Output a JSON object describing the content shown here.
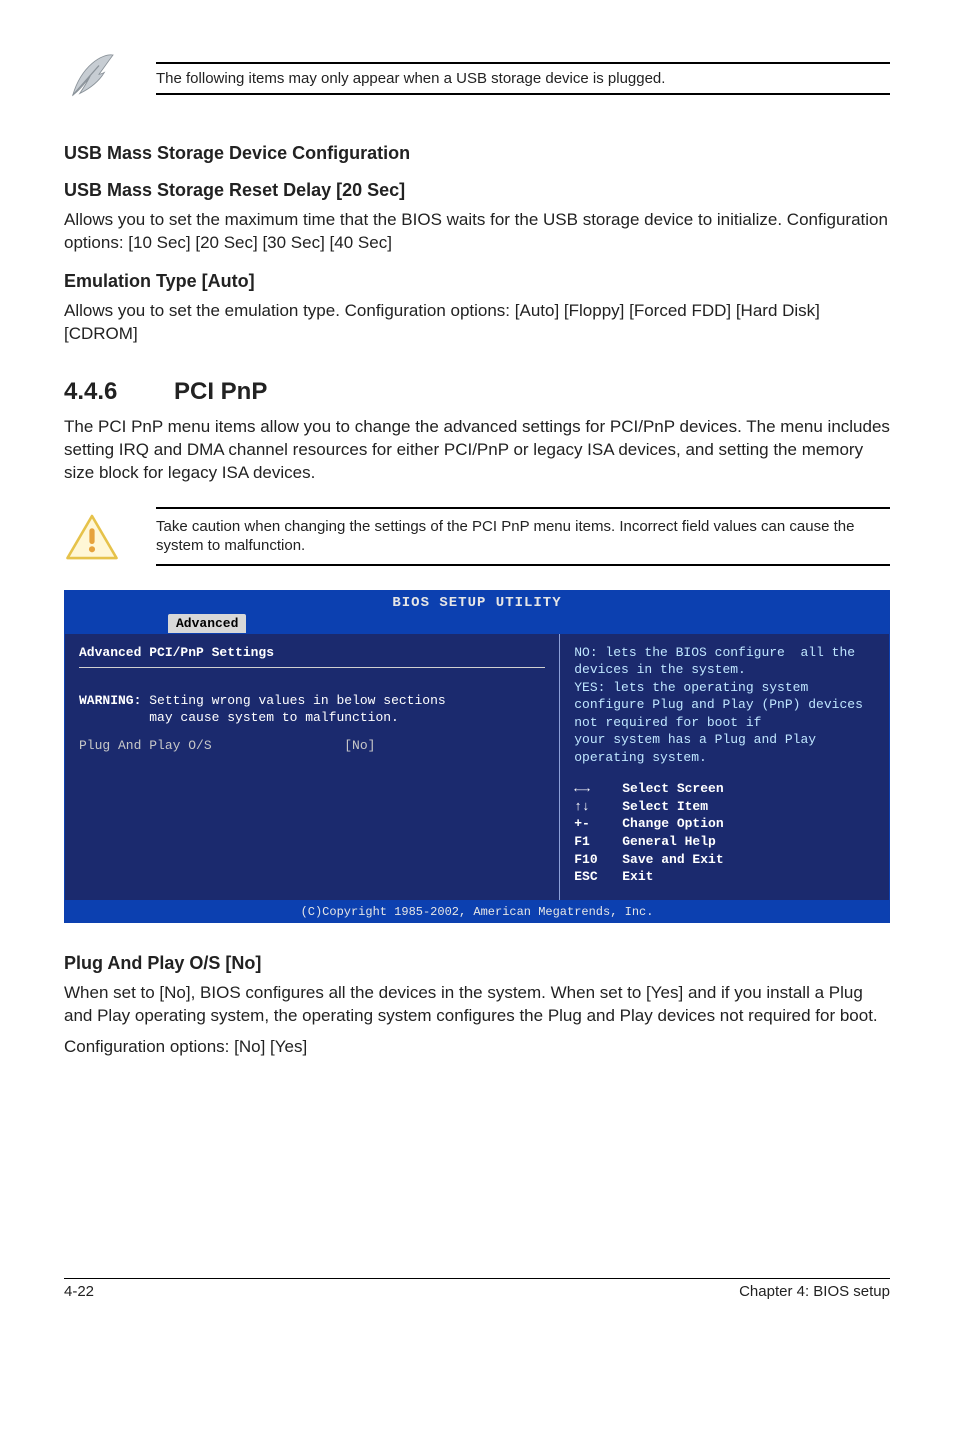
{
  "topnote": {
    "text": "The following items may only appear when a USB storage device is plugged."
  },
  "usbConfig": {
    "heading": "USB Mass Storage Device Configuration",
    "resetDelayHeading": "USB Mass Storage Reset Delay [20 Sec]",
    "resetDelayBody": "Allows you to set the maximum time that the BIOS waits for the USB storage device to initialize. Configuration options: [10 Sec] [20 Sec] [30 Sec] [40 Sec]",
    "emulationHeading": "Emulation Type [Auto]",
    "emulationBody": "Allows you to set the emulation type. Configuration options: [Auto] [Floppy] [Forced FDD] [Hard Disk] [CDROM]"
  },
  "section": {
    "number": "4.4.6",
    "title": "PCI PnP",
    "intro": "The PCI PnP menu items allow you to change the advanced settings for PCI/PnP devices. The menu includes setting IRQ and DMA channel resources for either PCI/PnP or legacy ISA devices, and setting the memory size block for legacy ISA devices."
  },
  "caution": {
    "text": "Take caution when changing the settings of the PCI PnP menu items. Incorrect field values can cause the system to malfunction."
  },
  "bios": {
    "title": "BIOS SETUP UTILITY",
    "tab": "Advanced",
    "leftTitle": "Advanced PCI/PnP Settings",
    "warningLabel": "WARNING:",
    "warningLine1": "Setting wrong values in below sections",
    "warningLine2": "may cause system to malfunction.",
    "optionLabel": "Plug And Play O/S",
    "optionValue": "[No]",
    "helpText": "NO: lets the BIOS configure  all the devices in the system.\nYES: lets the operating system configure Plug and Play (PnP) devices not required for boot if\nyour system has a Plug and Play operating system.",
    "keys": [
      {
        "sym": "←→",
        "label": "Select Screen"
      },
      {
        "sym": "↑↓",
        "label": "Select Item"
      },
      {
        "sym": "+-",
        "label": "Change Option"
      },
      {
        "sym": "F1",
        "label": "General Help"
      },
      {
        "sym": "F10",
        "label": "Save and Exit"
      },
      {
        "sym": "ESC",
        "label": "Exit"
      }
    ],
    "footer": "(C)Copyright 1985-2002, American Megatrends, Inc."
  },
  "plugPlay": {
    "heading": "Plug And Play O/S [No]",
    "body": "When set to [No], BIOS configures all the devices in the system. When set to [Yes] and if you install a Plug and Play operating system, the operating system configures the Plug and Play devices not required for boot.",
    "configLine": "Configuration options: [No] [Yes]"
  },
  "footer": {
    "pageNum": "4-22",
    "chapter": "Chapter 4: BIOS setup"
  }
}
